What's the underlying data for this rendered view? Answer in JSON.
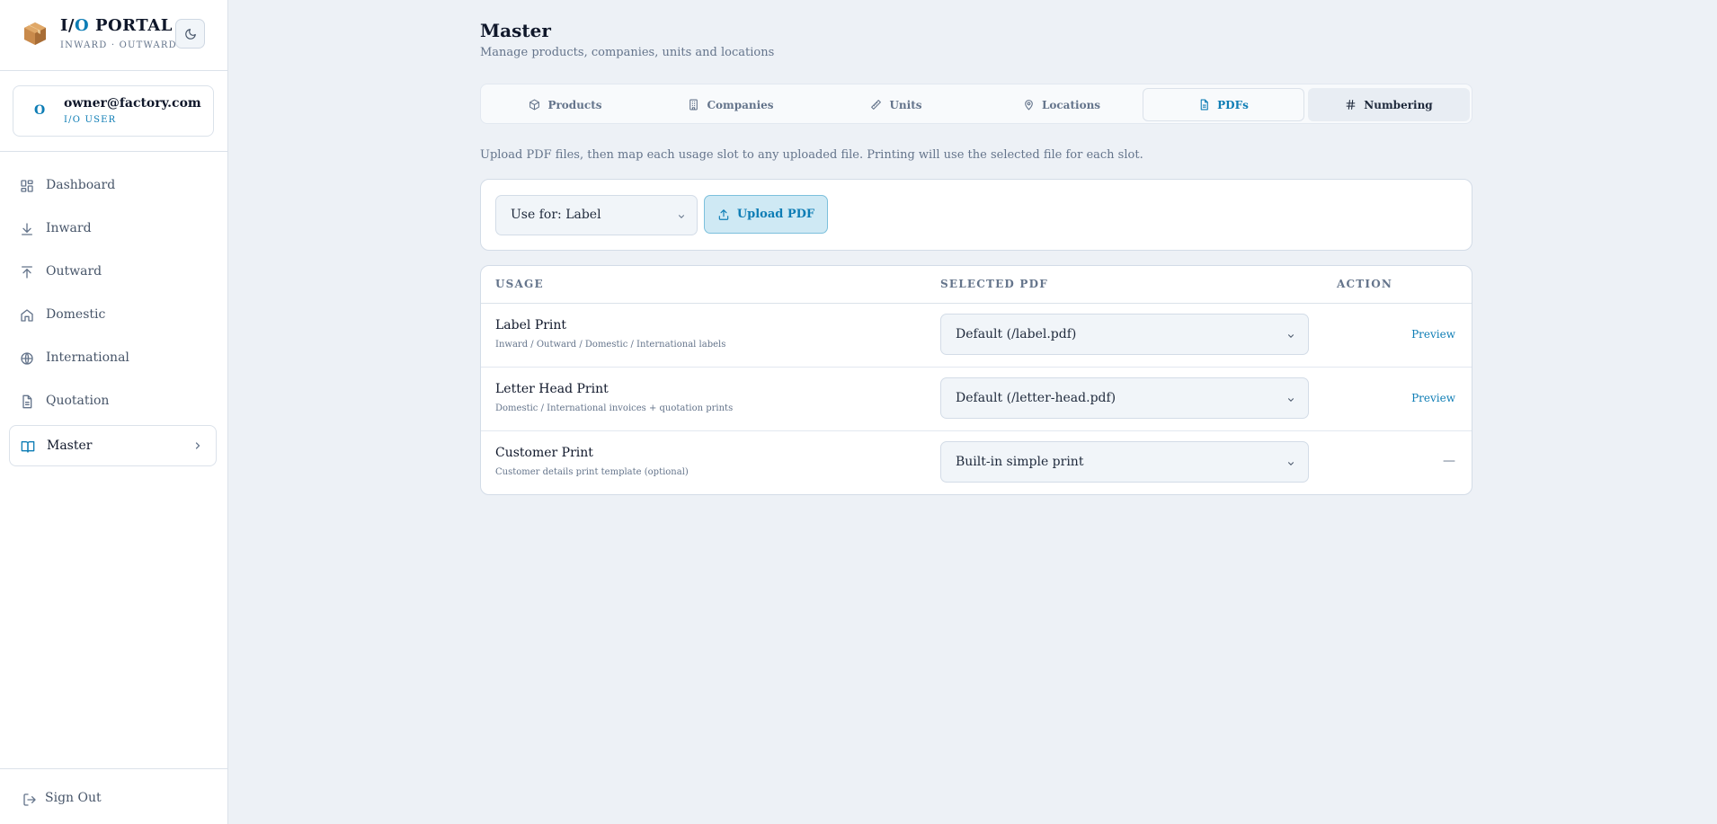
{
  "brand": {
    "title_prefix": "I/",
    "title_o": "O",
    "title_suffix": " PORTAL",
    "subtitle": "INWARD · OUTWARD",
    "logo_icon": "package-icon",
    "theme_icon": "moon-icon"
  },
  "user": {
    "avatar_initial": "O",
    "email": "owner@factory.com",
    "role": "I/O USER"
  },
  "sidebar": {
    "items": [
      {
        "label": "Dashboard",
        "icon": "dashboard-icon"
      },
      {
        "label": "Inward",
        "icon": "arrow-down-icon"
      },
      {
        "label": "Outward",
        "icon": "arrow-up-icon"
      },
      {
        "label": "Domestic",
        "icon": "home-icon"
      },
      {
        "label": "International",
        "icon": "globe-icon"
      },
      {
        "label": "Quotation",
        "icon": "document-icon"
      },
      {
        "label": "Master",
        "icon": "book-icon",
        "active": true
      }
    ],
    "signout": "Sign Out"
  },
  "page": {
    "title": "Master",
    "subtitle": "Manage products, companies, units and locations",
    "info": "Upload PDF files, then map each usage slot to any uploaded file. Printing will use the selected file for each slot."
  },
  "tabs": [
    {
      "label": "Products",
      "icon": "box-icon"
    },
    {
      "label": "Companies",
      "icon": "building-icon"
    },
    {
      "label": "Units",
      "icon": "ruler-icon"
    },
    {
      "label": "Locations",
      "icon": "map-pin-icon"
    },
    {
      "label": "PDFs",
      "icon": "file-icon",
      "active": true
    },
    {
      "label": "Numbering",
      "icon": "hash-icon"
    }
  ],
  "upload": {
    "use_for": "Use for: Label",
    "button": "Upload PDF"
  },
  "table": {
    "headers": [
      "USAGE",
      "SELECTED PDF",
      "ACTION"
    ],
    "rows": [
      {
        "name": "Label Print",
        "desc": "Inward / Outward / Domestic / International labels",
        "pdf": "Default (/label.pdf)",
        "action": "Preview"
      },
      {
        "name": "Letter Head Print",
        "desc": "Domestic / International invoices + quotation prints",
        "pdf": "Default (/letter-head.pdf)",
        "action": "Preview"
      },
      {
        "name": "Customer Print",
        "desc": "Customer details print template (optional)",
        "pdf": "Built-in simple print",
        "action": "—"
      }
    ]
  },
  "colors": {
    "accent": "#0e7db5",
    "background": "#edf1f6"
  }
}
